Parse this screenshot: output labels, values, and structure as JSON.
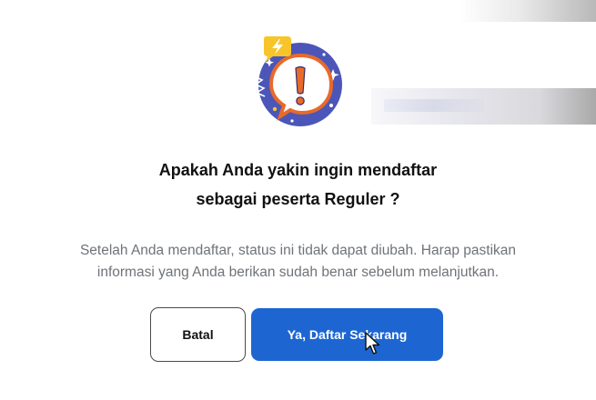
{
  "dialog": {
    "title_line1": "Apakah Anda yakin ingin mendaftar",
    "title_line2": "sebagai peserta Reguler ?",
    "description_line1": "Setelah Anda mendaftar, status ini tidak dapat diubah. Harap pastikan",
    "description_line2": "informasi yang Anda berikan sudah benar sebelum melanjutkan.",
    "cancel_label": "Batal",
    "confirm_label": "Ya, Daftar Sekarang",
    "illustration_icon": "warning-exclamation-icon",
    "cursor_icon": "mouse-pointer-icon"
  },
  "colors": {
    "confirm_button": "#1d66d2",
    "title_text": "#111111",
    "description_text": "#6f7378",
    "illustration_circle": "#4b56b8",
    "illustration_accent": "#e86a2a",
    "illustration_badge": "#f7c52a"
  }
}
